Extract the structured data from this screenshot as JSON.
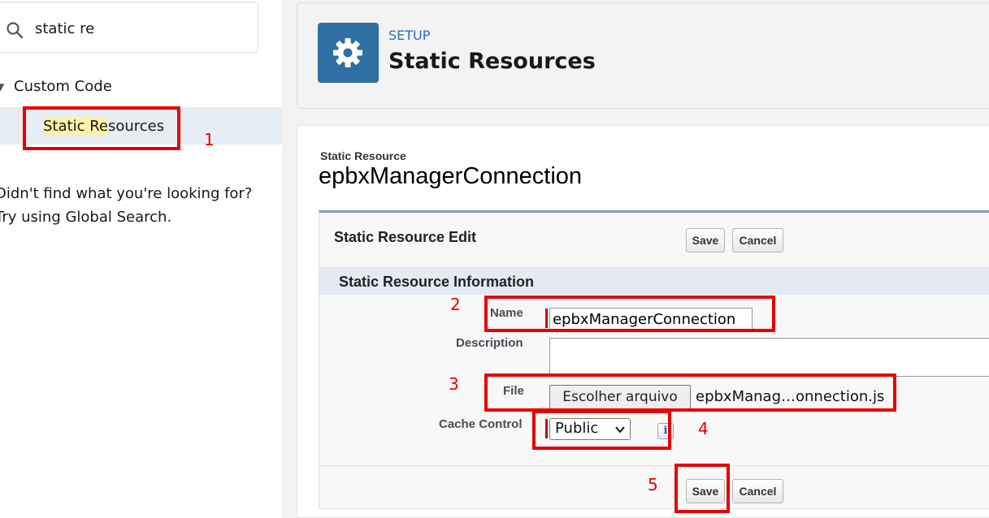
{
  "sidebar": {
    "search": {
      "value": "static re",
      "placeholder": ""
    },
    "tree": {
      "parent_label": "Custom Code",
      "child_label_highlight": "Static Re",
      "child_label_rest": "sources"
    },
    "not_found_line1": "Didn't find what you're looking for?",
    "not_found_line2": "Try using Global Search."
  },
  "header": {
    "icon": "gear-icon",
    "breadcrumb": "SETUP",
    "title": "Static Resources"
  },
  "record": {
    "type_label": "Static Resource",
    "name": "epbxManagerConnection"
  },
  "edit": {
    "title": "Static Resource Edit",
    "save_label": "Save",
    "cancel_label": "Cancel",
    "section_title": "Static Resource Information",
    "fields": {
      "name_label": "Name",
      "name_value": "epbxManagerConnection",
      "description_label": "Description",
      "description_value": "",
      "file_label": "File",
      "file_button_label": "Escolher arquivo",
      "file_name": "epbxManag…onnection.js",
      "cache_label": "Cache Control",
      "cache_value": "Public",
      "info_icon_glyph": "i"
    }
  },
  "annotations": {
    "color": "#e60000",
    "numbers": [
      "1",
      "2",
      "3",
      "4",
      "5"
    ]
  },
  "colors": {
    "tile": "#2f6fa3",
    "breadcrumb": "#2a6ebf",
    "selected_row": "#e6eef3",
    "highlight": "#fbf3a7"
  }
}
